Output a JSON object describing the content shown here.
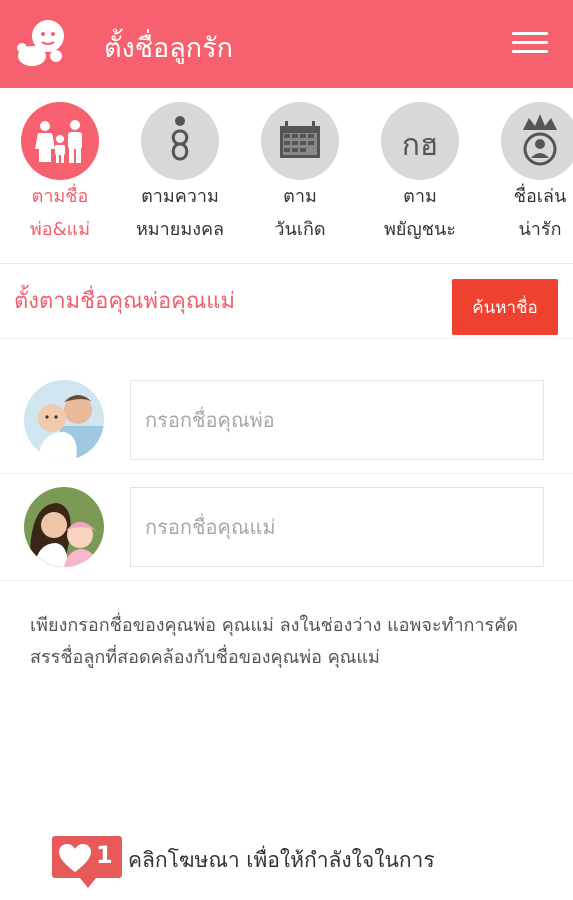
{
  "app": {
    "title": "ตั้งชื่อลูกรัก"
  },
  "categories": [
    {
      "line1": "ตามชื่อ",
      "line2": "พ่อ&แม่",
      "icon": "family-icon",
      "active": true
    },
    {
      "line1": "ตามความ",
      "line2": "หมายมงคล",
      "icon": "thai-numeral-icon",
      "active": false
    },
    {
      "line1": "ตาม",
      "line2": "วันเกิด",
      "icon": "calendar-icon",
      "active": false
    },
    {
      "line1": "ตาม",
      "line2": "พยัญชนะ",
      "icon": "thai-letters-icon",
      "glyph": "กฮ",
      "active": false
    },
    {
      "line1": "ชื่อเล่น",
      "line2": "น่ารัก",
      "icon": "crowned-child-icon",
      "active": false
    }
  ],
  "section": {
    "title": "ตั้งตามชื่อคุณพ่อคุณแม่",
    "search_label": "ค้นหาชื่อ"
  },
  "father": {
    "placeholder": "กรอกชื่อคุณพ่อ",
    "value": ""
  },
  "mother": {
    "placeholder": "กรอกชื่อคุณแม่",
    "value": ""
  },
  "description": "เพียงกรอกชื่อของคุณพ่อ คุณแม่ ลงในช่องว่าง แอพจะทำการคัดสรรชื่อลูกที่สอดคล้องกับชื่อของคุณพ่อ คุณแม่",
  "ad": {
    "count": "1",
    "text": "คลิกโฆษณา เพื่อให้กำลังใจในการ"
  },
  "colors": {
    "primary": "#f7606f",
    "accent": "#ee4130",
    "inactive_icon": "#d8d8d8"
  }
}
